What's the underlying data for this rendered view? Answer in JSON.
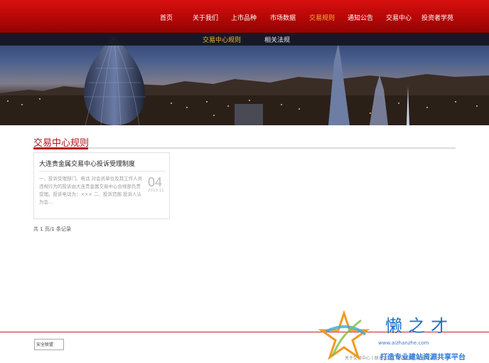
{
  "nav": {
    "items": [
      {
        "label": "首页"
      },
      {
        "label": "关于我们"
      },
      {
        "label": "上市品种"
      },
      {
        "label": "市场数据"
      },
      {
        "label": "交易规则"
      },
      {
        "label": "通知公告"
      },
      {
        "label": "交易中心"
      },
      {
        "label": "投资者学苑"
      }
    ],
    "active_index": 4
  },
  "subnav": {
    "items": [
      {
        "label": "交易中心规则"
      },
      {
        "label": "相关法规"
      }
    ],
    "active_index": 0
  },
  "section": {
    "title": "交易中心规则"
  },
  "articles": [
    {
      "title": "大连贵金属交易中心投诉受理制度",
      "excerpt": "一、投诉受理部门、电话 对会员单位及其工作人员违规行为的投诉由大连贵金属交易中心合规部负责受理。投诉电话为：×××  二、投诉范围 投诉人认为会...",
      "day": "04",
      "year_month": "2013.11"
    }
  ],
  "pagination": {
    "text": "共 1 页/1 条记录"
  },
  "footer": {
    "badge_label": "安全联盟",
    "links_text": "关于交易中心 | 联系我们 | 网站地图 | 交易中心 |"
  },
  "watermark": {
    "brand": "懒之才",
    "url": "www.aizhanzhe.com",
    "slogan": "打造专业建站资源共享平台"
  },
  "colors": {
    "brand_red": "#b3121a",
    "nav_active": "#f3b43a"
  }
}
